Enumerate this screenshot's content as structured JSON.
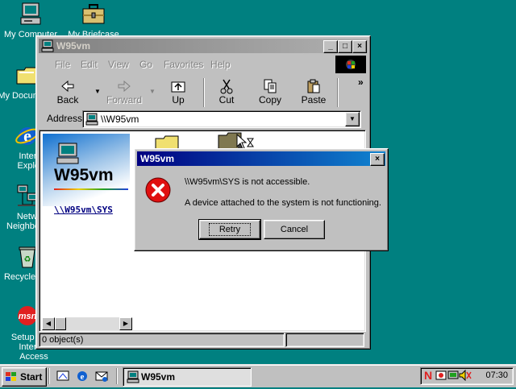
{
  "desktop": {
    "icons": [
      {
        "label": "My Computer"
      },
      {
        "label": "My Briefcase"
      },
      {
        "label": "My Documents"
      },
      {
        "label": "Internet Explorer"
      },
      {
        "label": "Network Neighborhood"
      },
      {
        "label": "Recycle Bin"
      },
      {
        "label": "Setup MSN Internet Access"
      }
    ]
  },
  "explorer": {
    "title": "W95vm",
    "title_buttons": {
      "minimize": "_",
      "maximize": "□",
      "close": "×"
    },
    "menu": [
      "File",
      "Edit",
      "View",
      "Go",
      "Favorites",
      "Help"
    ],
    "toolbar": {
      "back": "Back",
      "forward": "Forward",
      "up": "Up",
      "cut": "Cut",
      "copy": "Copy",
      "paste": "Paste",
      "more": "»"
    },
    "address": {
      "label": "Address",
      "value": "\\\\W95vm"
    },
    "webview": {
      "title": "W95vm",
      "link": "\\\\W95vm\\SYS"
    },
    "status": "0 object(s)"
  },
  "dialog": {
    "title": "W95vm",
    "close": "×",
    "message_line1": "\\\\W95vm\\SYS is not accessible.",
    "message_line2": "A device attached to the system is not functioning.",
    "retry_label": "Retry",
    "cancel_label": "Cancel"
  },
  "taskbar": {
    "start_label": "Start",
    "task_label": "W95vm",
    "clock": "07:30"
  },
  "colors": {
    "desktop": "#008080",
    "title_active": "#000080",
    "error_red": "#e01010",
    "link": "#000080"
  }
}
